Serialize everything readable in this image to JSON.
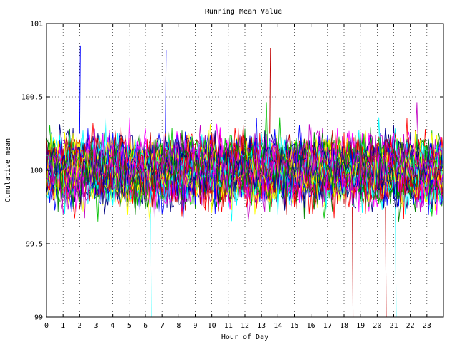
{
  "chart_data": {
    "type": "line",
    "title": "Running Mean Value",
    "xlabel": "Hour of Day",
    "ylabel": "Cumulative mean",
    "xlim": [
      0,
      24
    ],
    "ylim": [
      99,
      101
    ],
    "xticks": [
      "0",
      "1",
      "2",
      "3",
      "4",
      "5",
      "6",
      "7",
      "8",
      "9",
      "10",
      "11",
      "12",
      "13",
      "14",
      "15",
      "16",
      "17",
      "18",
      "19",
      "20",
      "21",
      "22",
      "23"
    ],
    "yticks": [
      "99",
      "99.5",
      "100",
      "100.5",
      "101"
    ],
    "grid": true,
    "legend": "none",
    "series_band": {
      "center": 100.0,
      "typical_spread": 0.25,
      "max_excursion": 0.85,
      "count_visible": 60,
      "points_per_hour": 10
    },
    "palette": [
      "#ff0000",
      "#00c000",
      "#0000ff",
      "#ff00ff",
      "#00ffff",
      "#c00000",
      "#ffff00",
      "#008000",
      "#000080",
      "#c000c0"
    ],
    "notable_excursions": [
      {
        "x": 6.3,
        "y": 99.0,
        "color": "#00ffff"
      },
      {
        "x": 18.5,
        "y": 99.0,
        "color": "#c00000"
      },
      {
        "x": 20.5,
        "y": 99.0,
        "color": "#c00000"
      },
      {
        "x": 21.1,
        "y": 99.0,
        "color": "#00ffff"
      },
      {
        "x": 2.0,
        "y": 100.85,
        "color": "#0000ff"
      },
      {
        "x": 7.2,
        "y": 100.82,
        "color": "#0000ff"
      },
      {
        "x": 13.5,
        "y": 100.83,
        "color": "#c00000"
      }
    ]
  }
}
